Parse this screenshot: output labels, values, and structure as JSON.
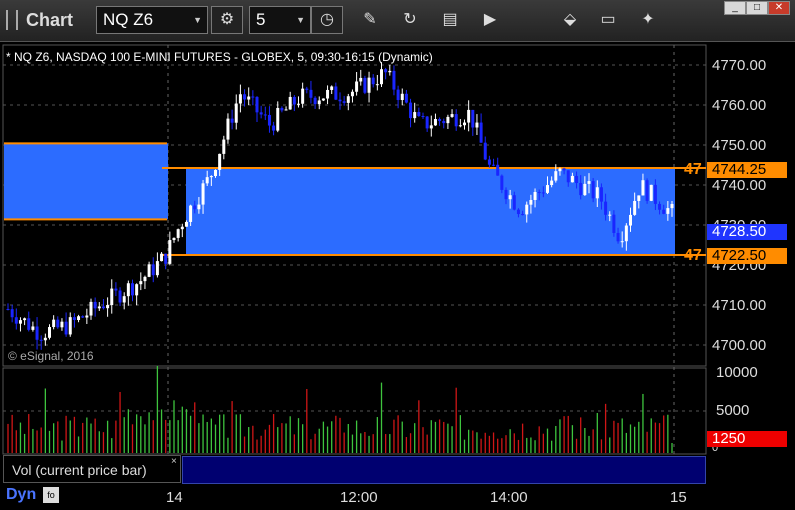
{
  "toolbar": {
    "chart_label": "Chart",
    "symbol": "NQ Z6",
    "interval": "5",
    "gear_icon": "gear-icon",
    "clock_icon": "clock-icon"
  },
  "chart": {
    "title": "* NQ Z6, NASDAQ 100 E-MINI FUTURES - GLOBEX, 5, 09:30-16:15 (Dynamic)",
    "copyright": "© eSignal, 2016",
    "price_axis": [
      "4770.00",
      "4760.00",
      "4750.00",
      "4740.00",
      "4730.00",
      "4720.00",
      "4710.00",
      "4700.00"
    ],
    "time_axis": [
      "14",
      "12:00",
      "14:00",
      "15"
    ],
    "tags": {
      "upper_level": "4744.25",
      "last_price": "4728.50",
      "lower_level": "4722.50",
      "level_mark_upper": "47",
      "level_mark_lower": "47"
    },
    "colors": {
      "zone": "#2c6cff",
      "level": "#ff8c00",
      "up": "#ffffff",
      "down": "#1a26ff"
    }
  },
  "volume": {
    "axis": [
      "10000",
      "5000",
      "0"
    ],
    "current": "1250",
    "panel_label": "Vol (current price bar)",
    "close_label": "×"
  },
  "footer": {
    "label": "Dyn"
  },
  "chart_data": {
    "type": "candlestick",
    "title": "* NQ Z6, NASDAQ 100 E-MINI FUTURES - GLOBEX, 5, 09:30-16:15 (Dynamic)",
    "ylim": [
      4697,
      4774
    ],
    "levels": [
      4744.25,
      4722.5
    ],
    "last_price": 4728.5,
    "volume_last": 1250,
    "volume_ylim": [
      0,
      10000
    ]
  }
}
